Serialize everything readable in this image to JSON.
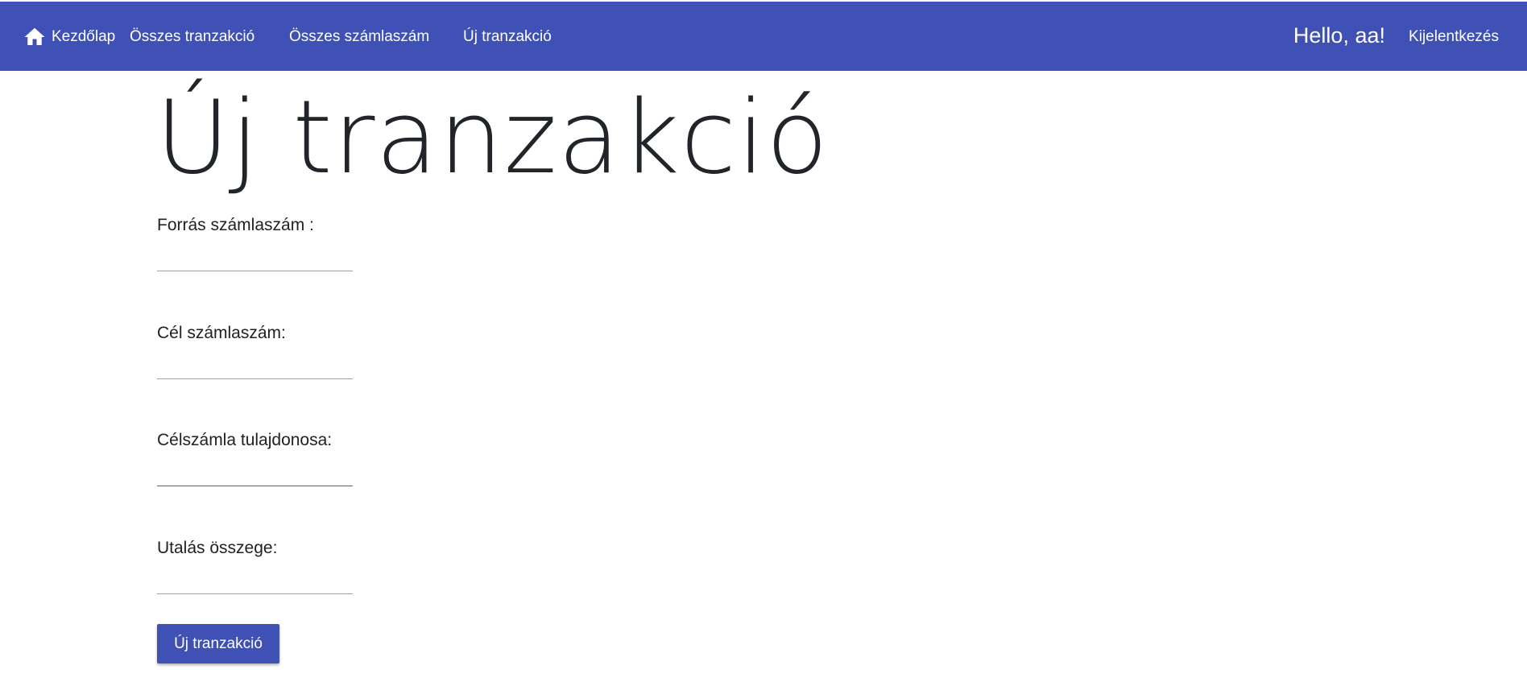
{
  "navbar": {
    "home_icon": "home-icon",
    "home_label": "Kezdőlap",
    "links": [
      {
        "label": "Összes tranzakció"
      },
      {
        "label": "Összes számlaszám"
      },
      {
        "label": "Új tranzakció"
      }
    ],
    "greeting": "Hello, aa!",
    "logout_label": "Kijelentkezés",
    "background_color": "#3f51b5"
  },
  "page": {
    "title": "Új tranzakció"
  },
  "form": {
    "fields": [
      {
        "label": "Forrás számlaszám :",
        "value": ""
      },
      {
        "label": "Cél számlaszám:",
        "value": ""
      },
      {
        "label": "Célszámla tulajdonosa:",
        "value": ""
      },
      {
        "label": "Utalás összege:",
        "value": ""
      }
    ],
    "submit_label": "Új tranzakció"
  }
}
